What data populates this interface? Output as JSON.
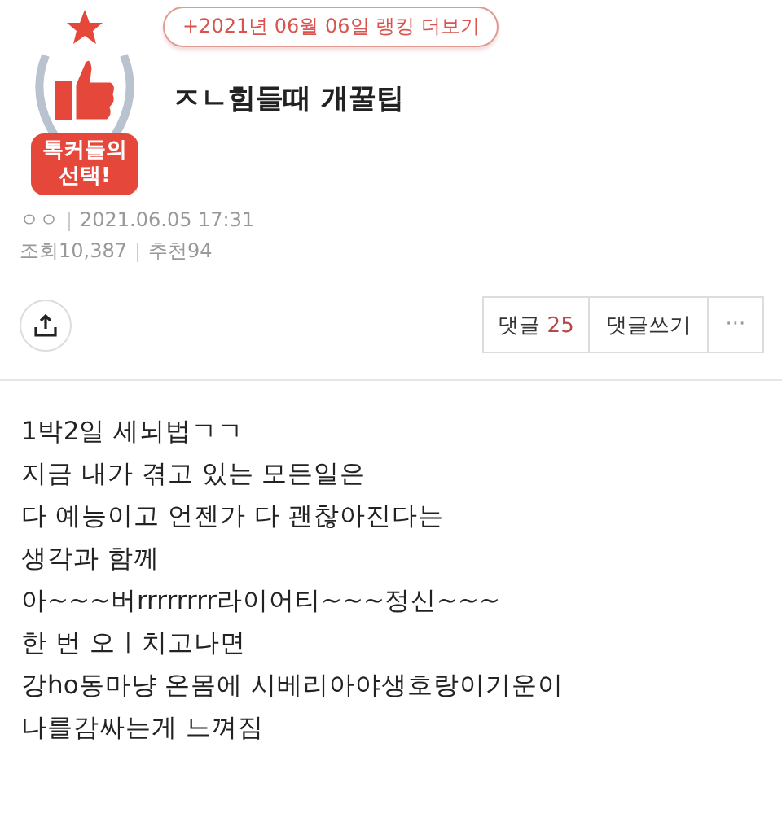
{
  "badge": {
    "lines": [
      "톡커들의",
      "선택!"
    ]
  },
  "ranking_link": "+2021년 06월 06일 랭킹 더보기",
  "title": "ㅈㄴ힘들때 개꿀팁",
  "meta": {
    "author": "ㅇㅇ",
    "date": "2021.06.05 17:31",
    "views": "조회10,387",
    "recommend": "추천94"
  },
  "actions": {
    "comment_label": "댓글",
    "comment_count": "25",
    "write_comment": "댓글쓰기",
    "more": "···"
  },
  "body": [
    "1박2일 세뇌법ㄱㄱ",
    "지금 내가 겪고 있는 모든일은",
    "다 예능이고 언젠가 다 괜찮아진다는",
    "생각과 함께",
    "아~~~버rrrrrrrr라이어티~~~정신~~~",
    "한 번 오ㅣ치고나면",
    "강ho동마냥 온몸에 시베리아야생호랑이기운이",
    "나를감싸는게 느껴짐"
  ]
}
